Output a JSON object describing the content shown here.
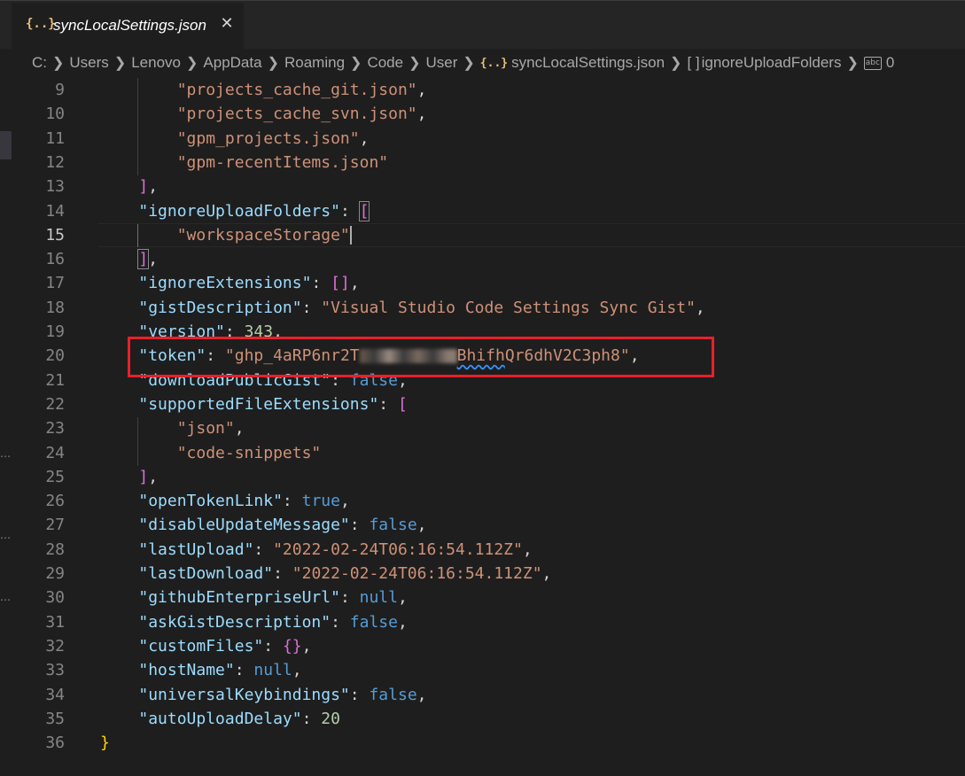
{
  "tab": {
    "icon": "{..}",
    "label": "syncLocalSettings.json",
    "close": "✕"
  },
  "breadcrumb": {
    "items": [
      "C:",
      "Users",
      "Lenovo",
      "AppData",
      "Roaming",
      "Code",
      "User"
    ],
    "file": "syncLocalSettings.json",
    "file_icon": "{..}",
    "array_icon": "[ ]",
    "array": "ignoreUploadFolders",
    "value_icon": "abc",
    "value": "0"
  },
  "lines": [
    {
      "n": "9"
    },
    {
      "n": "10"
    },
    {
      "n": "11"
    },
    {
      "n": "12"
    },
    {
      "n": "13"
    },
    {
      "n": "14"
    },
    {
      "n": "15"
    },
    {
      "n": "16"
    },
    {
      "n": "17"
    },
    {
      "n": "18"
    },
    {
      "n": "19"
    },
    {
      "n": "20"
    },
    {
      "n": "21"
    },
    {
      "n": "22"
    },
    {
      "n": "23"
    },
    {
      "n": "24"
    },
    {
      "n": "25"
    },
    {
      "n": "26"
    },
    {
      "n": "27"
    },
    {
      "n": "28"
    },
    {
      "n": "29"
    },
    {
      "n": "30"
    },
    {
      "n": "31"
    },
    {
      "n": "32"
    },
    {
      "n": "33"
    },
    {
      "n": "34"
    },
    {
      "n": "35"
    },
    {
      "n": "36"
    }
  ],
  "code": {
    "l9": "\"projects_cache_git.json\"",
    "l10": "\"projects_cache_svn.json\"",
    "l11": "\"gpm_projects.json\"",
    "l12": "\"gpm-recentItems.json\"",
    "l14k": "\"ignoreUploadFolders\"",
    "l15": "\"workspaceStorage\"",
    "l17k": "\"ignoreExtensions\"",
    "l18k": "\"gistDescription\"",
    "l18v": "\"Visual Studio Code Settings Sync Gist\"",
    "l19k": "\"version\"",
    "l19v": "343",
    "l20k": "\"token\"",
    "l20a": "\"ghp_4aRP6nr2T",
    "l20b": "Bhifh",
    "l20c": "Qr6dhV2C3ph8\"",
    "l21k": "\"downloadPublicGist\"",
    "l21v": "false",
    "l22k": "\"supportedFileExtensions\"",
    "l23": "\"json\"",
    "l24": "\"code-snippets\"",
    "l26k": "\"openTokenLink\"",
    "l26v": "true",
    "l27k": "\"disableUpdateMessage\"",
    "l27v": "false",
    "l28k": "\"lastUpload\"",
    "l28v": "\"2022-02-24T06:16:54.112Z\"",
    "l29k": "\"lastDownload\"",
    "l29v": "\"2022-02-24T06:16:54.112Z\"",
    "l30k": "\"githubEnterpriseUrl\"",
    "l30v": "null",
    "l31k": "\"askGistDescription\"",
    "l31v": "false",
    "l32k": "\"customFiles\"",
    "l33k": "\"hostName\"",
    "l33v": "null",
    "l34k": "\"universalKeybindings\"",
    "l34v": "false",
    "l35k": "\"autoUploadDelay\"",
    "l35v": "20"
  },
  "colors": {
    "key": "#9cdcfe",
    "string": "#ce9178",
    "number": "#b5cea8",
    "keyword": "#569cd6",
    "highlight": "#e8202a"
  }
}
